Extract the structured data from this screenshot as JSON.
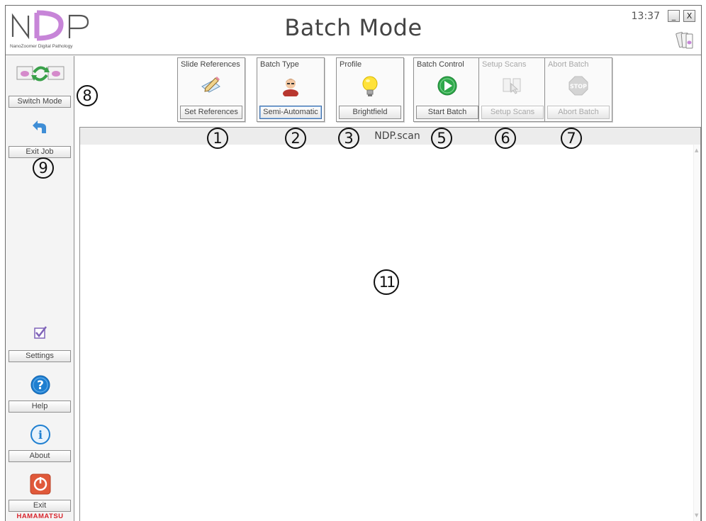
{
  "window": {
    "title": "Batch Mode",
    "clock": "13:37",
    "minimize_label": "_",
    "close_label": "X"
  },
  "logo": {
    "text": "NDP",
    "subtitle": "NanoZoomer Digital Pathology"
  },
  "sidebar": {
    "switch_mode": "Switch Mode",
    "exit_job": "Exit Job",
    "settings": "Settings",
    "help": "Help",
    "about": "About",
    "exit": "Exit",
    "brand": "HAMAMATSU"
  },
  "toolbar": {
    "panels": [
      {
        "title": "Slide References",
        "button": "Set References",
        "icon": "slide-pencil-icon",
        "disabled": false,
        "selected": false
      },
      {
        "title": "Batch Type",
        "button": "Semi-Automatic",
        "icon": "person-icon",
        "disabled": false,
        "selected": true
      },
      {
        "title": "Profile",
        "button": "Brightfield",
        "icon": "lightbulb-icon",
        "disabled": false,
        "selected": false
      },
      {
        "title": "Batch Control",
        "button": "Start Batch",
        "icon": "play-icon",
        "disabled": false,
        "selected": false
      },
      {
        "title": "Setup Scans",
        "button": "Setup Scans",
        "icon": "setup-scans-icon",
        "disabled": true,
        "selected": false
      },
      {
        "title": "Abort Batch",
        "button": "Abort Batch",
        "icon": "stop-icon",
        "disabled": true,
        "selected": false
      }
    ]
  },
  "content": {
    "title": "NDP.scan"
  },
  "callouts": {
    "c1": "1",
    "c2": "2",
    "c3": "3",
    "c5": "5",
    "c6": "6",
    "c7": "7",
    "c8": "8",
    "c9": "9",
    "c11": "11"
  },
  "colors": {
    "brand_red": "#d8262e",
    "logo_pink": "#c785d8",
    "play_green": "#2fa84a",
    "help_blue": "#1f7fd0",
    "exit_orange": "#e0593a"
  }
}
